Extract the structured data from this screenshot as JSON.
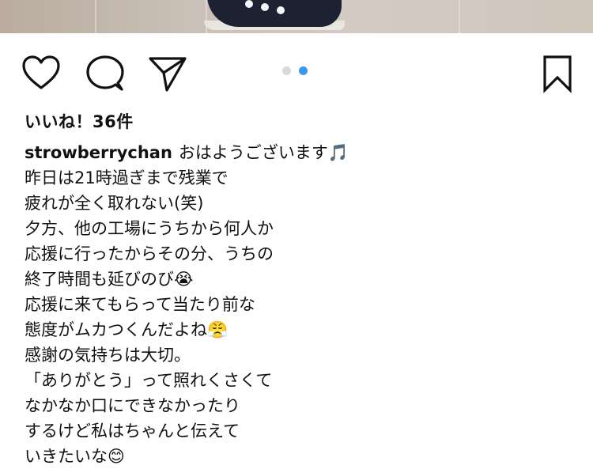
{
  "post": {
    "likes_text": "いいね！36件",
    "username": "strowberrychan",
    "caption_first": "おはようございます🎵",
    "caption_lines": [
      "昨日は21時過ぎまで残業で",
      "疲れが全く取れない(笑)",
      "夕方、他の工場にうちから何人か",
      "応援に行ったからその分、うちの",
      "終了時間も延びのび😭",
      "応援に来てもらって当たり前な",
      "態度がムカつくんだよね😤",
      "感謝の気持ちは大切。",
      "「ありがとう」って照れくさくて",
      "なかなか口にできなかったり",
      "するけど私はちゃんと伝えて",
      "いきたいな😊"
    ]
  },
  "carousel": {
    "dot_inactive_color": "#d8d8d8",
    "dot_active_color": "#3897f0"
  },
  "icons": {
    "like": "heart-icon",
    "comment": "comment-icon",
    "share": "paper-plane-icon",
    "save": "bookmark-icon"
  }
}
